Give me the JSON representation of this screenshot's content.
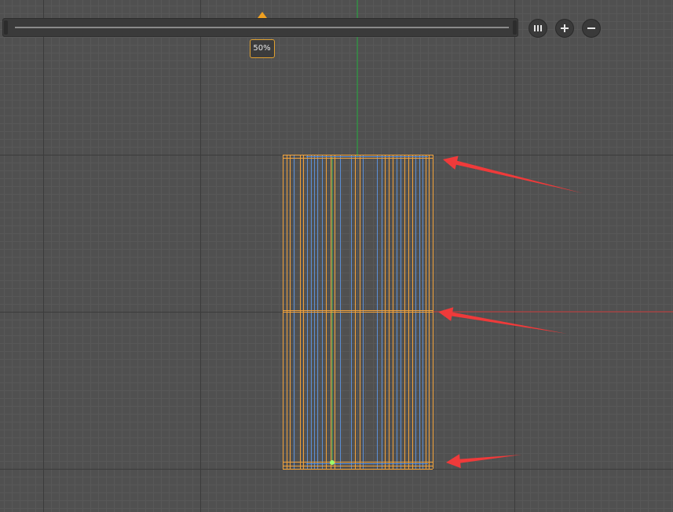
{
  "zoom": {
    "value": 0.5,
    "label": "50%"
  },
  "toolbar": {
    "buttons": [
      {
        "name": "columns-view-button",
        "icon": "columns-icon"
      },
      {
        "name": "zoom-in-button",
        "icon": "plus-icon"
      },
      {
        "name": "zoom-out-button",
        "icon": "minus-icon"
      }
    ]
  },
  "colors": {
    "background": "#505050",
    "grid_major": "#3c3c3c",
    "grid_minor": "#585858",
    "axis_y": "#1faa3a",
    "axis_x": "#c83a3a",
    "mesh_orange": "#f2a23a",
    "mesh_blue": "#5b8fd6",
    "annotation_red": "#ef3a3a",
    "pivot": "#9cff6a"
  },
  "annotations": {
    "arrow_count": 3
  }
}
